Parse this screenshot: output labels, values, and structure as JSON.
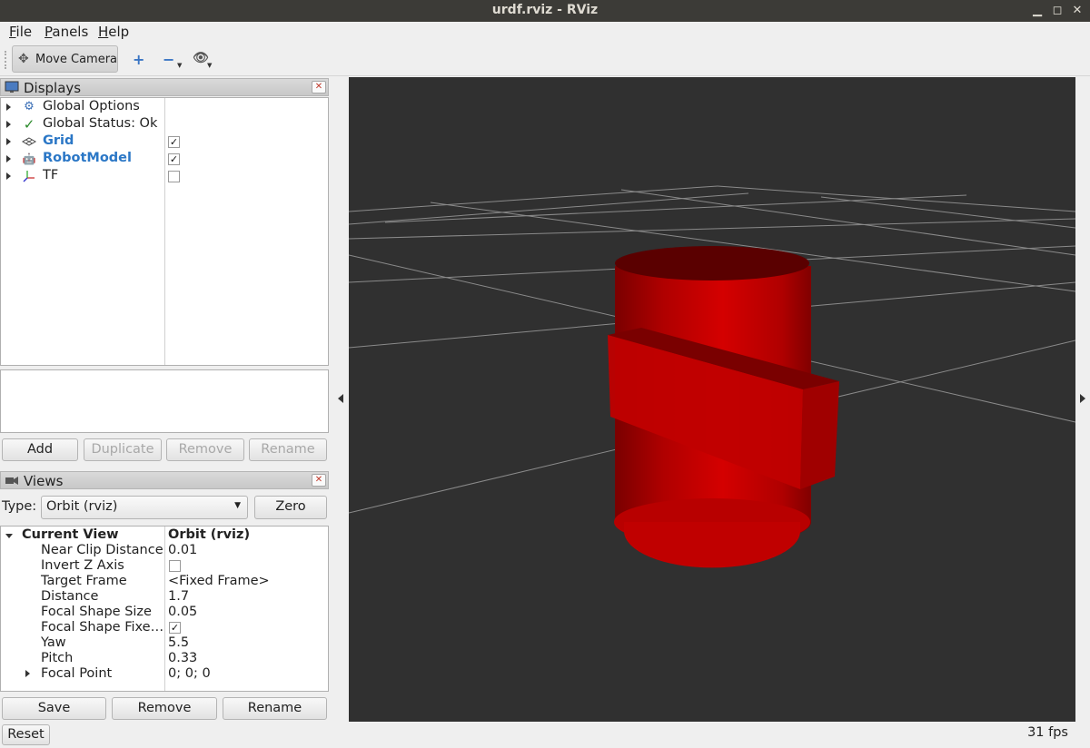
{
  "window": {
    "title": "urdf.rviz - RViz"
  },
  "menu": {
    "items": [
      {
        "label": "File",
        "accel": "F",
        "rest": "ile"
      },
      {
        "label": "Panels",
        "accel": "P",
        "rest": "anels"
      },
      {
        "label": "Help",
        "accel": "H",
        "rest": "elp"
      }
    ]
  },
  "toolbar": {
    "move_camera": "Move Camera"
  },
  "displays": {
    "title": "Displays",
    "items": [
      {
        "label": "Global Options",
        "icon": "gear-icon",
        "checkbox": null
      },
      {
        "label": "Global Status: Ok",
        "icon": "checkmark-icon",
        "checkbox": null
      },
      {
        "label": "Grid",
        "icon": "grid-icon",
        "checkbox": true,
        "highlight": true
      },
      {
        "label": "RobotModel",
        "icon": "robot-icon",
        "checkbox": true,
        "highlight": true
      },
      {
        "label": "TF",
        "icon": "axes-icon",
        "checkbox": false
      }
    ],
    "buttons": {
      "add": "Add",
      "duplicate": "Duplicate",
      "remove": "Remove",
      "rename": "Rename"
    }
  },
  "views": {
    "title": "Views",
    "type_label": "Type:",
    "type_value": "Orbit (rviz)",
    "zero": "Zero",
    "current_view": "Current View",
    "current_view_value": "Orbit (rviz)",
    "props": [
      {
        "name": "Near Clip Distance",
        "value": "0.01"
      },
      {
        "name": "Invert Z Axis",
        "value": "",
        "checkbox": false
      },
      {
        "name": "Target Frame",
        "value": "<Fixed Frame>"
      },
      {
        "name": "Distance",
        "value": "1.7"
      },
      {
        "name": "Focal Shape Size",
        "value": "0.05"
      },
      {
        "name": "Focal Shape Fixe…",
        "value": "",
        "checkbox": true
      },
      {
        "name": "Yaw",
        "value": "5.5"
      },
      {
        "name": "Pitch",
        "value": "0.33"
      },
      {
        "name": "Focal Point",
        "value": "0; 0; 0",
        "expandable": true
      }
    ],
    "buttons": {
      "save": "Save",
      "remove": "Remove",
      "rename": "Rename"
    }
  },
  "status": {
    "reset": "Reset",
    "fps": "31 fps"
  },
  "colors": {
    "viewport_bg": "#303030",
    "robot_red": "#c00000",
    "highlight_blue": "#2b77c6"
  }
}
